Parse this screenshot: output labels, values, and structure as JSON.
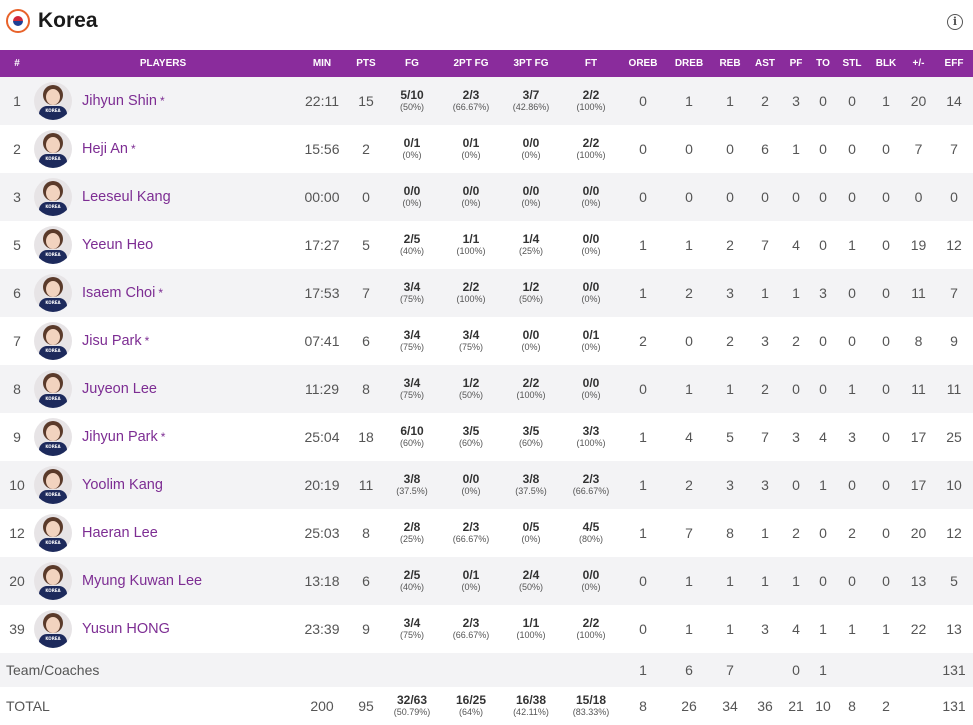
{
  "team": {
    "name": "Korea",
    "flag_icon": "korea-flag-icon",
    "info_icon": "info-icon"
  },
  "colors": {
    "header_bg": "#8a2c9c",
    "player_name": "#7d2d93",
    "stripe": "#f3f3f5"
  },
  "columns": [
    "#",
    "PLAYERS",
    "MIN",
    "PTS",
    "FG",
    "2PT FG",
    "3PT FG",
    "FT",
    "OREB",
    "DREB",
    "REB",
    "AST",
    "PF",
    "TO",
    "STL",
    "BLK",
    "+/-",
    "EFF"
  ],
  "jersey_text": "KOREA",
  "players": [
    {
      "no": "1",
      "name": "Jihyun Shin",
      "star": "*",
      "min": "22:11",
      "pts": "15",
      "fg": {
        "m": "5/10",
        "p": "(50%)"
      },
      "fg2": {
        "m": "2/3",
        "p": "(66.67%)"
      },
      "fg3": {
        "m": "3/7",
        "p": "(42.86%)"
      },
      "ft": {
        "m": "2/2",
        "p": "(100%)"
      },
      "oreb": "0",
      "dreb": "1",
      "reb": "1",
      "ast": "2",
      "pf": "3",
      "to": "0",
      "stl": "0",
      "blk": "1",
      "pm": "20",
      "eff": "14"
    },
    {
      "no": "2",
      "name": "Heji An",
      "star": "*",
      "min": "15:56",
      "pts": "2",
      "fg": {
        "m": "0/1",
        "p": "(0%)"
      },
      "fg2": {
        "m": "0/1",
        "p": "(0%)"
      },
      "fg3": {
        "m": "0/0",
        "p": "(0%)"
      },
      "ft": {
        "m": "2/2",
        "p": "(100%)"
      },
      "oreb": "0",
      "dreb": "0",
      "reb": "0",
      "ast": "6",
      "pf": "1",
      "to": "0",
      "stl": "0",
      "blk": "0",
      "pm": "7",
      "eff": "7"
    },
    {
      "no": "3",
      "name": "Leeseul Kang",
      "star": "",
      "min": "00:00",
      "pts": "0",
      "fg": {
        "m": "0/0",
        "p": "(0%)"
      },
      "fg2": {
        "m": "0/0",
        "p": "(0%)"
      },
      "fg3": {
        "m": "0/0",
        "p": "(0%)"
      },
      "ft": {
        "m": "0/0",
        "p": "(0%)"
      },
      "oreb": "0",
      "dreb": "0",
      "reb": "0",
      "ast": "0",
      "pf": "0",
      "to": "0",
      "stl": "0",
      "blk": "0",
      "pm": "0",
      "eff": "0"
    },
    {
      "no": "5",
      "name": "Yeeun Heo",
      "star": "",
      "min": "17:27",
      "pts": "5",
      "fg": {
        "m": "2/5",
        "p": "(40%)"
      },
      "fg2": {
        "m": "1/1",
        "p": "(100%)"
      },
      "fg3": {
        "m": "1/4",
        "p": "(25%)"
      },
      "ft": {
        "m": "0/0",
        "p": "(0%)"
      },
      "oreb": "1",
      "dreb": "1",
      "reb": "2",
      "ast": "7",
      "pf": "4",
      "to": "0",
      "stl": "1",
      "blk": "0",
      "pm": "19",
      "eff": "12"
    },
    {
      "no": "6",
      "name": "Isaem Choi",
      "star": "*",
      "min": "17:53",
      "pts": "7",
      "fg": {
        "m": "3/4",
        "p": "(75%)"
      },
      "fg2": {
        "m": "2/2",
        "p": "(100%)"
      },
      "fg3": {
        "m": "1/2",
        "p": "(50%)"
      },
      "ft": {
        "m": "0/0",
        "p": "(0%)"
      },
      "oreb": "1",
      "dreb": "2",
      "reb": "3",
      "ast": "1",
      "pf": "1",
      "to": "3",
      "stl": "0",
      "blk": "0",
      "pm": "11",
      "eff": "7"
    },
    {
      "no": "7",
      "name": "Jisu Park",
      "star": "*",
      "min": "07:41",
      "pts": "6",
      "fg": {
        "m": "3/4",
        "p": "(75%)"
      },
      "fg2": {
        "m": "3/4",
        "p": "(75%)"
      },
      "fg3": {
        "m": "0/0",
        "p": "(0%)"
      },
      "ft": {
        "m": "0/1",
        "p": "(0%)"
      },
      "oreb": "2",
      "dreb": "0",
      "reb": "2",
      "ast": "3",
      "pf": "2",
      "to": "0",
      "stl": "0",
      "blk": "0",
      "pm": "8",
      "eff": "9"
    },
    {
      "no": "8",
      "name": "Juyeon Lee",
      "star": "",
      "min": "11:29",
      "pts": "8",
      "fg": {
        "m": "3/4",
        "p": "(75%)"
      },
      "fg2": {
        "m": "1/2",
        "p": "(50%)"
      },
      "fg3": {
        "m": "2/2",
        "p": "(100%)"
      },
      "ft": {
        "m": "0/0",
        "p": "(0%)"
      },
      "oreb": "0",
      "dreb": "1",
      "reb": "1",
      "ast": "2",
      "pf": "0",
      "to": "0",
      "stl": "1",
      "blk": "0",
      "pm": "11",
      "eff": "11"
    },
    {
      "no": "9",
      "name": "Jihyun Park",
      "star": "*",
      "min": "25:04",
      "pts": "18",
      "fg": {
        "m": "6/10",
        "p": "(60%)"
      },
      "fg2": {
        "m": "3/5",
        "p": "(60%)"
      },
      "fg3": {
        "m": "3/5",
        "p": "(60%)"
      },
      "ft": {
        "m": "3/3",
        "p": "(100%)"
      },
      "oreb": "1",
      "dreb": "4",
      "reb": "5",
      "ast": "7",
      "pf": "3",
      "to": "4",
      "stl": "3",
      "blk": "0",
      "pm": "17",
      "eff": "25"
    },
    {
      "no": "10",
      "name": "Yoolim Kang",
      "star": "",
      "min": "20:19",
      "pts": "11",
      "fg": {
        "m": "3/8",
        "p": "(37.5%)"
      },
      "fg2": {
        "m": "0/0",
        "p": "(0%)"
      },
      "fg3": {
        "m": "3/8",
        "p": "(37.5%)"
      },
      "ft": {
        "m": "2/3",
        "p": "(66.67%)"
      },
      "oreb": "1",
      "dreb": "2",
      "reb": "3",
      "ast": "3",
      "pf": "0",
      "to": "1",
      "stl": "0",
      "blk": "0",
      "pm": "17",
      "eff": "10"
    },
    {
      "no": "12",
      "name": "Haeran Lee",
      "star": "",
      "min": "25:03",
      "pts": "8",
      "fg": {
        "m": "2/8",
        "p": "(25%)"
      },
      "fg2": {
        "m": "2/3",
        "p": "(66.67%)"
      },
      "fg3": {
        "m": "0/5",
        "p": "(0%)"
      },
      "ft": {
        "m": "4/5",
        "p": "(80%)"
      },
      "oreb": "1",
      "dreb": "7",
      "reb": "8",
      "ast": "1",
      "pf": "2",
      "to": "0",
      "stl": "2",
      "blk": "0",
      "pm": "20",
      "eff": "12"
    },
    {
      "no": "20",
      "name": "Myung Kuwan Lee",
      "star": "",
      "min": "13:18",
      "pts": "6",
      "fg": {
        "m": "2/5",
        "p": "(40%)"
      },
      "fg2": {
        "m": "0/1",
        "p": "(0%)"
      },
      "fg3": {
        "m": "2/4",
        "p": "(50%)"
      },
      "ft": {
        "m": "0/0",
        "p": "(0%)"
      },
      "oreb": "0",
      "dreb": "1",
      "reb": "1",
      "ast": "1",
      "pf": "1",
      "to": "0",
      "stl": "0",
      "blk": "0",
      "pm": "13",
      "eff": "5"
    },
    {
      "no": "39",
      "name": "Yusun HONG",
      "star": "",
      "min": "23:39",
      "pts": "9",
      "fg": {
        "m": "3/4",
        "p": "(75%)"
      },
      "fg2": {
        "m": "2/3",
        "p": "(66.67%)"
      },
      "fg3": {
        "m": "1/1",
        "p": "(100%)"
      },
      "ft": {
        "m": "2/2",
        "p": "(100%)"
      },
      "oreb": "0",
      "dreb": "1",
      "reb": "1",
      "ast": "3",
      "pf": "4",
      "to": "1",
      "stl": "1",
      "blk": "1",
      "pm": "22",
      "eff": "13"
    }
  ],
  "coaches": {
    "label": "Team/Coaches",
    "oreb": "1",
    "dreb": "6",
    "reb": "7",
    "ast": "",
    "pf": "0",
    "to": "1",
    "stl": "",
    "blk": "",
    "pm": "",
    "eff": "131"
  },
  "total": {
    "label": "TOTAL",
    "min": "200",
    "pts": "95",
    "fg": {
      "m": "32/63",
      "p": "(50.79%)"
    },
    "fg2": {
      "m": "16/25",
      "p": "(64%)"
    },
    "fg3": {
      "m": "16/38",
      "p": "(42.11%)"
    },
    "ft": {
      "m": "15/18",
      "p": "(83.33%)"
    },
    "oreb": "8",
    "dreb": "26",
    "reb": "34",
    "ast": "36",
    "pf": "21",
    "to": "10",
    "stl": "8",
    "blk": "2",
    "pm": "",
    "eff": "131"
  }
}
